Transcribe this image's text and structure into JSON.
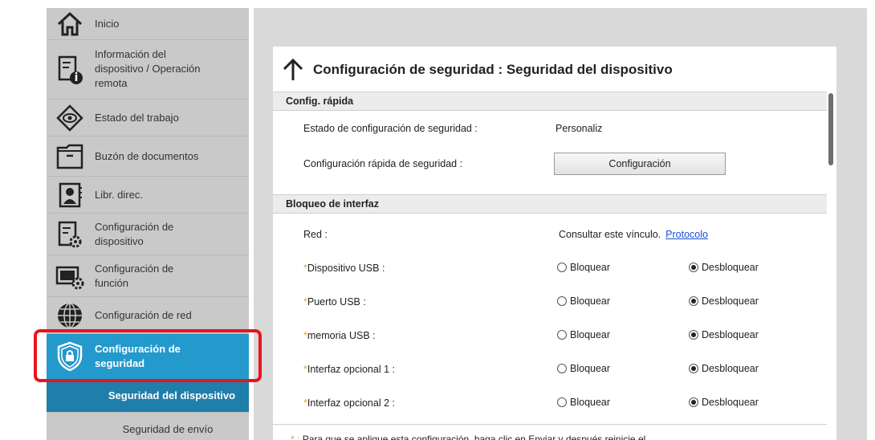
{
  "sidebar": {
    "items": [
      {
        "label": "Inicio",
        "icon": "home-icon"
      },
      {
        "label": "Información del\ndispositivo / Operación\nremota",
        "icon": "device-info-icon"
      },
      {
        "label": "Estado del trabajo",
        "icon": "job-status-icon"
      },
      {
        "label": "Buzón de documentos",
        "icon": "document-box-icon"
      },
      {
        "label": "Libr. direc.",
        "icon": "address-book-icon"
      },
      {
        "label": "Configuración de\ndispositivo",
        "icon": "device-settings-icon"
      },
      {
        "label": "Configuración de\nfunción",
        "icon": "function-settings-icon"
      },
      {
        "label": "Configuración de red",
        "icon": "network-globe-icon"
      },
      {
        "label": "Configuración de\nseguridad",
        "icon": "security-shield-icon"
      }
    ],
    "sub_active": "Seguridad del dispositivo",
    "sub_next": "Seguridad de envío"
  },
  "page": {
    "title": "Configuración de seguridad : Seguridad del dispositivo"
  },
  "quick": {
    "header": "Config. rápida",
    "status_label": "Estado de configuración de seguridad :",
    "status_value": "Personaliz",
    "quick_label": "Configuración rápida de seguridad :",
    "quick_button": "Configuración"
  },
  "interface_lock": {
    "header": "Bloqueo de interfaz",
    "network_label": "Red :",
    "network_text": "Consultar este vínculo.",
    "network_link": "Protocolo",
    "lock_label": "Bloquear",
    "unlock_label": "Desbloquear",
    "asterisk": "*",
    "rows": [
      {
        "label": "Dispositivo USB :",
        "selected": "Desbloquear"
      },
      {
        "label": "Puerto USB :",
        "selected": "Desbloquear"
      },
      {
        "label": "memoria USB :",
        "selected": "Desbloquear"
      },
      {
        "label": "Interfaz opcional 1 :",
        "selected": "Desbloquear"
      },
      {
        "label": "Interfaz opcional 2 :",
        "selected": "Desbloquear"
      }
    ]
  },
  "footer": {
    "asterisk": "* :",
    "note": "Para que se aplique esta configuración, haga clic en Enviar y después reinicie el"
  },
  "colors": {
    "active_item": "#2399cc",
    "active_sub": "#1f7eaa",
    "highlight_border": "#e8141e",
    "link": "#1a4fd6",
    "asterisk": "#e5a13c"
  }
}
